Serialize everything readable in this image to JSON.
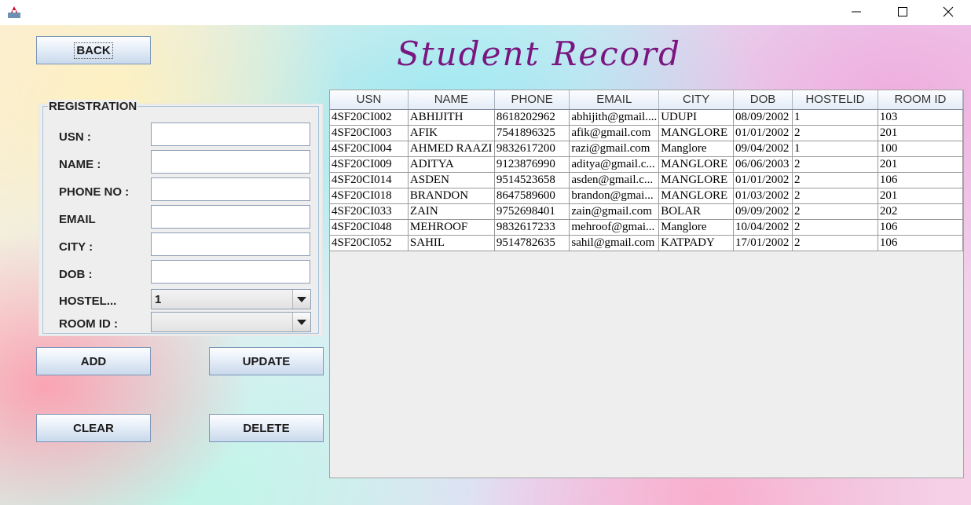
{
  "window": {
    "icon": "java-app-icon",
    "minimize_icon": "minimize-icon",
    "maximize_icon": "maximize-icon",
    "close_icon": "close-icon"
  },
  "header": {
    "back_label": "BACK",
    "title": "Student Record"
  },
  "registration": {
    "title": "REGISTRATION",
    "usn_label": "USN :",
    "name_label": "NAME :",
    "phone_label": "PHONE NO :",
    "email_label": "EMAIL",
    "city_label": "CITY :",
    "dob_label": "DOB :",
    "hostel_label": "HOSTEL...",
    "room_label": "ROOM ID :",
    "usn_value": "",
    "name_value": "",
    "phone_value": "",
    "email_value": "",
    "city_value": "",
    "dob_value": "",
    "hostel_value": "1",
    "room_value": ""
  },
  "actions": {
    "add": "ADD",
    "update": "UPDATE",
    "clear": "CLEAR",
    "delete": "DELETE"
  },
  "table": {
    "columns": [
      "USN",
      "NAME",
      "PHONE",
      "EMAIL",
      "CITY",
      "DOB",
      "HOSTELID",
      "ROOM ID"
    ],
    "rows": [
      [
        "4SF20CI002",
        "ABHIJITH",
        "8618202962",
        "abhijith@gmail....",
        "UDUPI",
        "08/09/2002",
        "1",
        "103"
      ],
      [
        "4SF20CI003",
        "AFIK",
        "7541896325",
        "afik@gmail.com",
        "MANGLORE",
        "01/01/2002",
        "2",
        "201"
      ],
      [
        "4SF20CI004",
        "AHMED RAAZI",
        "9832617200",
        "razi@gmail.com",
        "Manglore",
        "09/04/2002",
        "1",
        "100"
      ],
      [
        "4SF20CI009",
        "ADITYA",
        "9123876990",
        "aditya@gmail.c...",
        "MANGLORE",
        "06/06/2003",
        "2",
        "201"
      ],
      [
        "4SF20CI014",
        "ASDEN",
        "9514523658",
        "asden@gmail.c...",
        "MANGLORE",
        "01/01/2002",
        "2",
        "106"
      ],
      [
        "4SF20CI018",
        "BRANDON",
        "8647589600",
        "brandon@gmai...",
        "MANGLORE",
        "01/03/2002",
        "2",
        "201"
      ],
      [
        "4SF20CI033",
        "ZAIN",
        "9752698401",
        "zain@gmail.com",
        "BOLAR",
        "09/09/2002",
        "2",
        "202"
      ],
      [
        "4SF20CI048",
        "MEHROOF",
        "9832617233",
        "mehroof@gmai...",
        "Manglore",
        "10/04/2002",
        "2",
        "106"
      ],
      [
        "4SF20CI052",
        "SAHIL",
        "9514782635",
        "sahil@gmail.com",
        "KATPADY",
        "17/01/2002",
        "2",
        "106"
      ]
    ]
  },
  "colors": {
    "title": "#7a1680",
    "table_header": "#e4ecf6",
    "panel": "#eeeeee"
  }
}
